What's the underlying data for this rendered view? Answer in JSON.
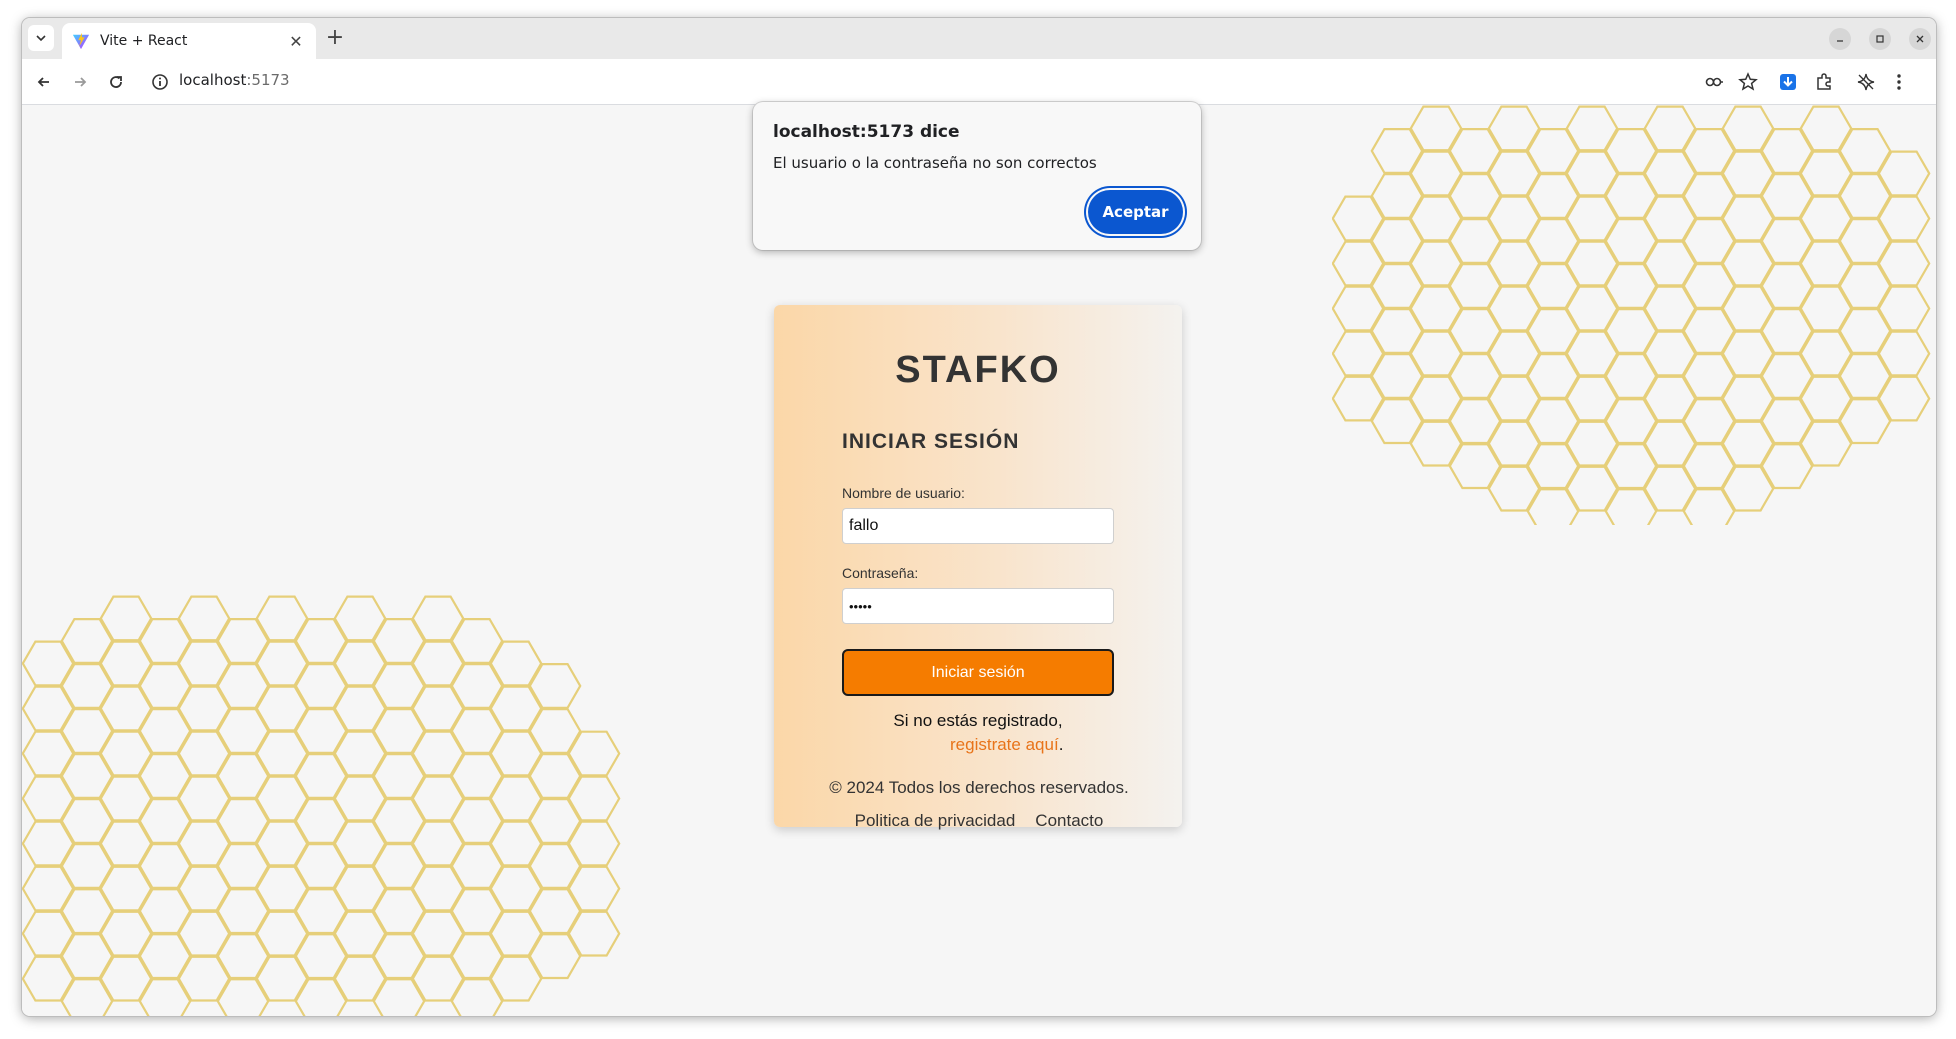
{
  "browser": {
    "tab_title": "Vite + React",
    "url_host": "localhost",
    "url_port": ":5173"
  },
  "dialog": {
    "title": "localhost:5173 dice",
    "message": "El usuario o la contraseña no son correctos",
    "button": "Aceptar"
  },
  "login": {
    "brand": "STAFKO",
    "title": "INICIAR SESIÓN",
    "username_label": "Nombre de usuario:",
    "username_value": "fallo",
    "password_label": "Contraseña:",
    "password_value": "•••••",
    "submit": "Iniciar sesión",
    "register_text": "Si no estás registrado,",
    "register_link": "registrate aquí",
    "register_suffix": "."
  },
  "footer": {
    "copyright": "© 2024 Todos los derechos reservados.",
    "links": [
      "Politica de privacidad",
      "Contacto"
    ]
  },
  "colors": {
    "accent": "#f57c00",
    "link": "#e8741a",
    "dialog_button": "#0b57d0",
    "honeycomb": "#e6cf7a"
  },
  "icons": [
    "tab-search-icon",
    "vite-favicon",
    "close-icon",
    "new-tab-icon",
    "minimize-icon",
    "maximize-icon",
    "window-close-icon",
    "back-icon",
    "forward-icon",
    "reload-icon",
    "site-info-icon",
    "password-key-icon",
    "bookmark-star-icon",
    "download-icon",
    "extensions-icon",
    "gemini-icon",
    "menu-dots-icon"
  ]
}
